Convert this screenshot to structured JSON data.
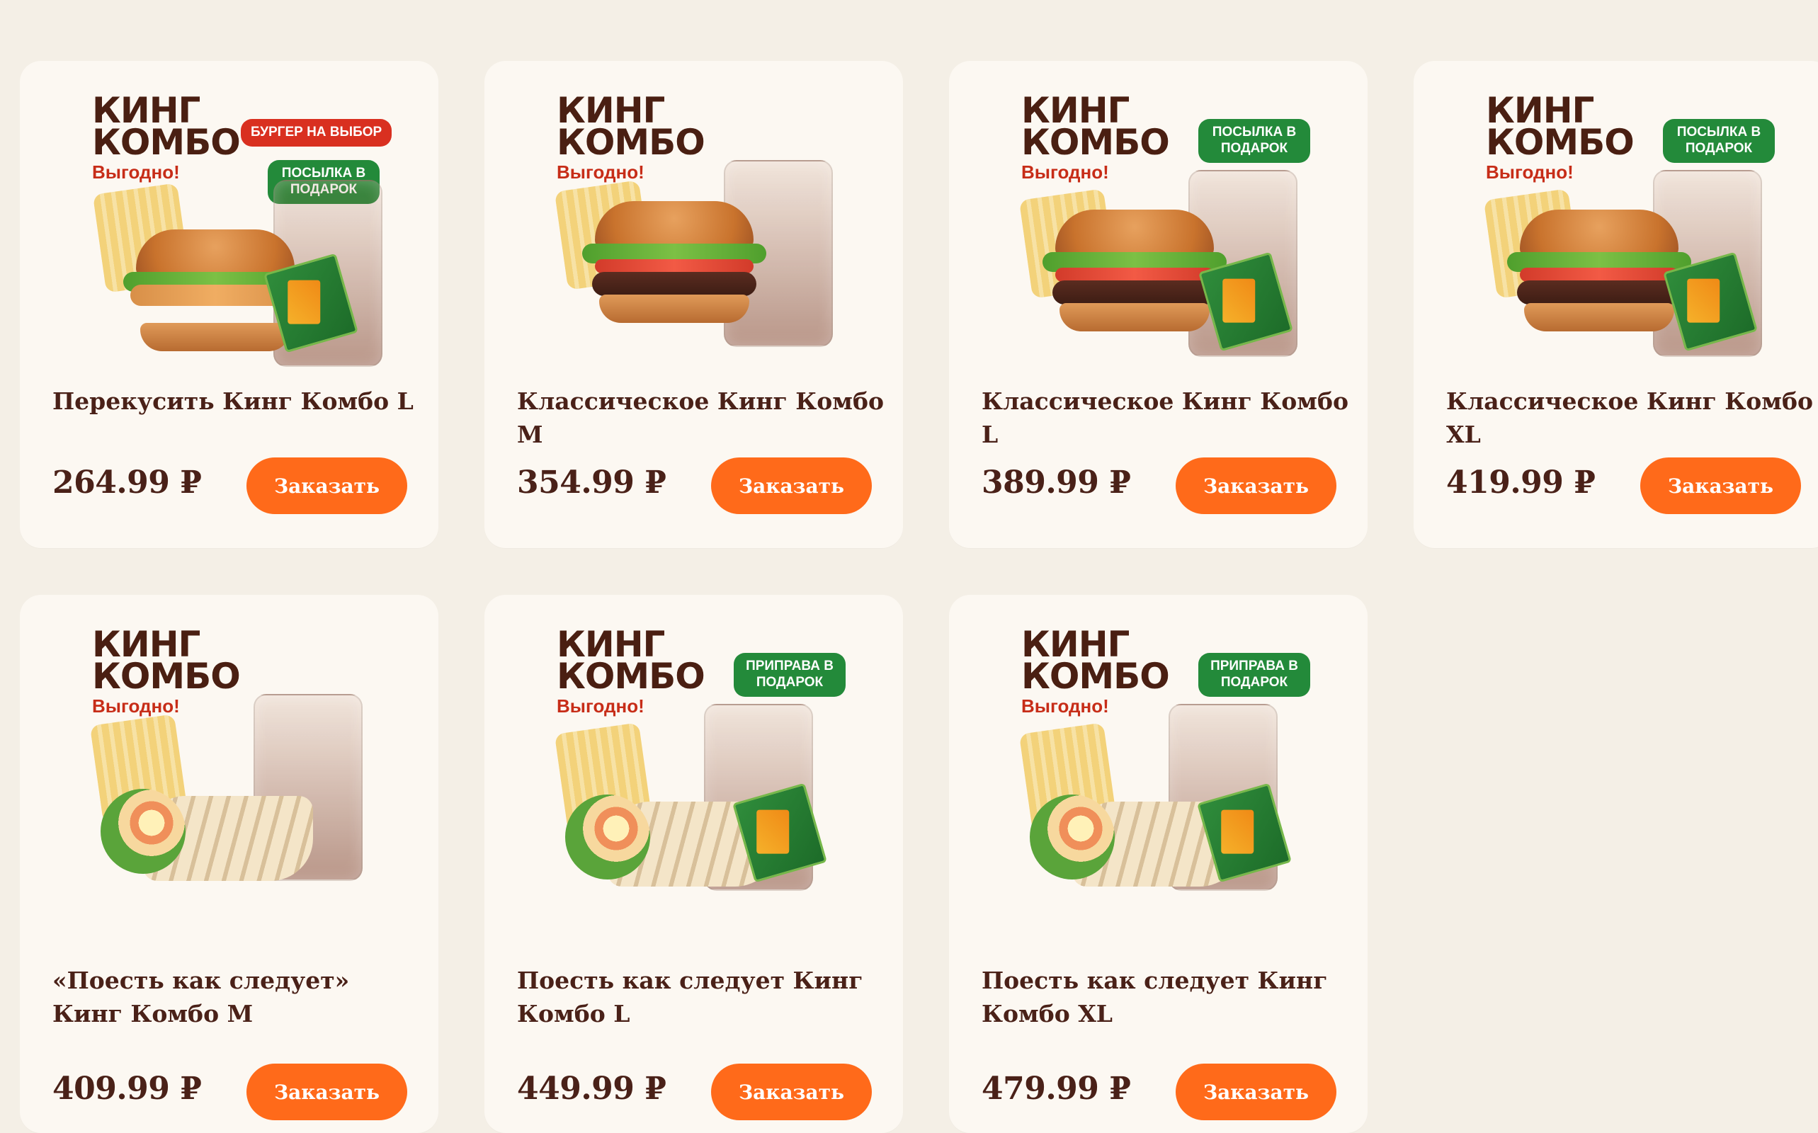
{
  "products": [
    {
      "title": "Перекусить Кинг Комбо L",
      "price": "264.99 ₽",
      "button_label": "Заказать",
      "brand": {
        "top": "КИНГ",
        "bottom": "КОМБО",
        "tag": "Выгодно!"
      },
      "badges": [
        {
          "text": "БУРГЕР НА ВЫБОР",
          "color": "#d93020"
        },
        {
          "text": "ПОСЫЛКА В ПОДАРОК",
          "color": "#238a3a"
        }
      ]
    },
    {
      "title": "Классическое Кинг Комбо M",
      "price": "354.99 ₽",
      "button_label": "Заказать",
      "brand": {
        "top": "КИНГ",
        "bottom": "КОМБО",
        "tag": "Выгодно!"
      },
      "badges": []
    },
    {
      "title": "Классическое Кинг Комбо L",
      "price": "389.99 ₽",
      "button_label": "Заказать",
      "brand": {
        "top": "КИНГ",
        "bottom": "КОМБО",
        "tag": "Выгодно!"
      },
      "badges": [
        {
          "text": "ПОСЫЛКА В ПОДАРОК",
          "color": "#238a3a"
        }
      ]
    },
    {
      "title": "Классическое Кинг Комбо XL",
      "price": "419.99 ₽",
      "button_label": "Заказать",
      "brand": {
        "top": "КИНГ",
        "bottom": "КОМБО",
        "tag": "Выгодно!"
      },
      "badges": [
        {
          "text": "ПОСЫЛКА В ПОДАРОК",
          "color": "#238a3a"
        }
      ]
    },
    {
      "title": "«Поесть как следует» Кинг Комбо M",
      "price": "409.99 ₽",
      "button_label": "Заказать",
      "brand": {
        "top": "КИНГ",
        "bottom": "КОМБО",
        "tag": "Выгодно!"
      },
      "badges": []
    },
    {
      "title": "Поесть как следует Кинг Комбо L",
      "price": "449.99 ₽",
      "button_label": "Заказать",
      "brand": {
        "top": "КИНГ",
        "bottom": "КОМБО",
        "tag": "Выгодно!"
      },
      "badges": [
        {
          "text": "ПРИПРАВА В ПОДАРОК",
          "color": "#238a3a"
        }
      ]
    },
    {
      "title": "Поесть как следует Кинг Комбо XL",
      "price": "479.99 ₽",
      "button_label": "Заказать",
      "brand": {
        "top": "КИНГ",
        "bottom": "КОМБО",
        "tag": "Выгодно!"
      },
      "badges": [
        {
          "text": "ПРИПРАВА В ПОДАРОК",
          "color": "#238a3a"
        }
      ]
    }
  ],
  "colors": {
    "page_bg": "#f4efe6",
    "card_bg": "#fcf8f2",
    "text_dark": "#4a2118",
    "accent_orange": "#ff6a1a",
    "brand_brown": "#4a1f12",
    "brand_red": "#c72d18",
    "badge_red": "#d93020",
    "badge_green": "#238a3a"
  },
  "icons": {
    "drink": "drink-icon",
    "fries": "fries-icon",
    "burger": "burger-icon",
    "wrap": "wrap-icon",
    "sauce": "sauce-packet-icon"
  }
}
